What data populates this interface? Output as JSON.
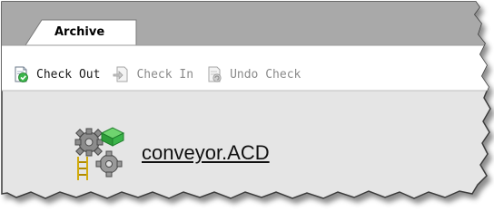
{
  "tab": {
    "label": "Archive"
  },
  "toolbar": {
    "check_out": {
      "label": "Check Out",
      "icon": "check-out-icon",
      "enabled": true
    },
    "check_in": {
      "label": "Check In",
      "icon": "check-in-icon",
      "enabled": false
    },
    "undo_check": {
      "label": "Undo Check",
      "icon": "undo-check-icon",
      "enabled": false
    }
  },
  "file": {
    "name": "conveyor.ACD",
    "icon": "acd-project-file-icon"
  },
  "colors": {
    "tabstrip_bg": "#a9a9a9",
    "tab_bg": "#ffffff",
    "toolbar_bg": "#ffffff",
    "content_bg": "#e5e5e5",
    "border": "#3a3a3a",
    "accent_green": "#3bb54a"
  }
}
